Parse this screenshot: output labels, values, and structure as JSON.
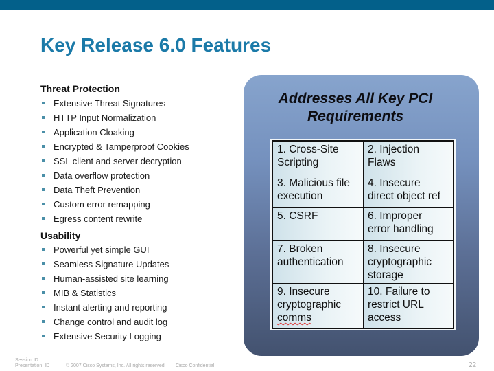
{
  "slide": {
    "title": "Key Release 6.0 Features",
    "accent_color": "#03608a",
    "title_color": "#1b7aa8"
  },
  "threat_protection": {
    "heading": "Threat Protection",
    "items": [
      "Extensive Threat Signatures",
      "HTTP Input Normalization",
      "Application Cloaking",
      "Encrypted & Tamperproof Cookies",
      "SSL client and server decryption",
      "Data overflow protection",
      "Data Theft Prevention",
      "Custom error remapping",
      "Egress content rewrite"
    ]
  },
  "usability": {
    "heading": "Usability",
    "items": [
      "Powerful yet simple GUI",
      "Seamless Signature Updates",
      "Human-assisted site learning",
      "MIB & Statistics",
      "Instant alerting and reporting",
      "Change control and audit log",
      "Extensive Security Logging"
    ]
  },
  "pci_panel": {
    "title_line1": "Addresses All Key PCI",
    "title_line2": "Requirements",
    "rows": [
      [
        {
          "line1": "1. Cross-Site",
          "line2": "Scripting"
        },
        {
          "line1": "2. Injection",
          "line2": "Flaws"
        }
      ],
      [
        {
          "line1": "3. Malicious file",
          "line2": "execution"
        },
        {
          "line1": "4. Insecure",
          "line2": "direct object ref"
        }
      ],
      [
        {
          "line1": "5. CSRF",
          "line2": ""
        },
        {
          "line1": "6. Improper",
          "line2": "error handling"
        }
      ],
      [
        {
          "line1": "7. Broken",
          "line2": "authentication",
          "line3": ""
        },
        {
          "line1": "8. Insecure",
          "line2": "cryptographic",
          "line3": "storage"
        }
      ],
      [
        {
          "line1": "9. Insecure",
          "line2": "cryptographic",
          "line3": "comms"
        },
        {
          "line1": "10. Failure to",
          "line2": "restrict URL",
          "line3": "access"
        }
      ]
    ]
  },
  "footer": {
    "session_id": "Session ID",
    "presentation_id": "Presentation_ID",
    "copyright": "© 2007 Cisco Systems, Inc. All rights reserved.",
    "confidential": "Cisco Confidential",
    "page_number": "22"
  }
}
